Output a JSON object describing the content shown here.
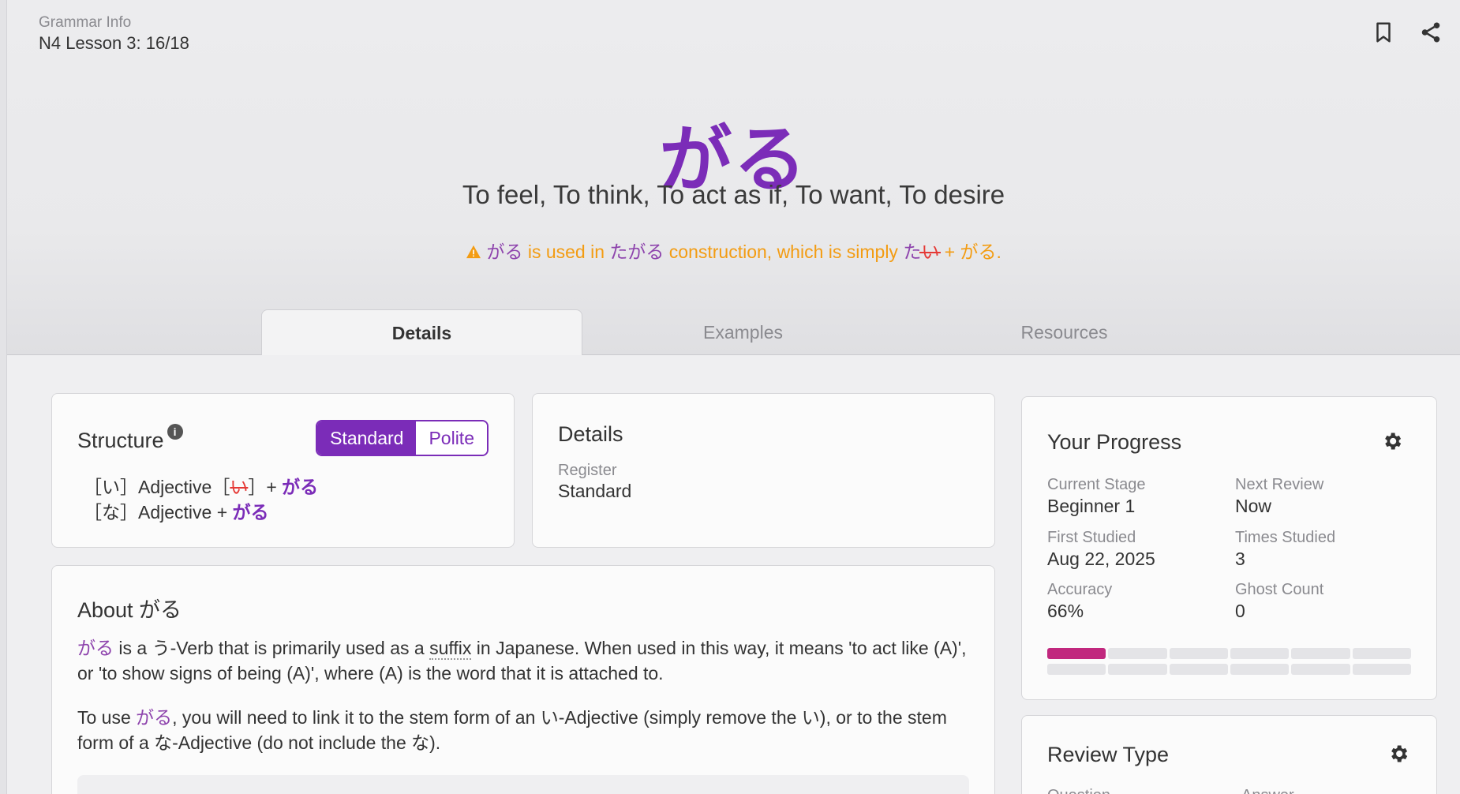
{
  "header": {
    "section_label": "Grammar Info",
    "lesson_label": "N4 Lesson 3: 16/18"
  },
  "icons": {
    "bookmark": "bookmark-icon",
    "share": "share-icon",
    "gear": "gear-icon",
    "warning": "warning-icon",
    "info": "info-icon"
  },
  "grammar": {
    "title": "がる",
    "meaning": "To feel, To think, To act as if, To want, To desire"
  },
  "warning": {
    "part1": "がる",
    "part2": " is used in ",
    "part3": "たがる",
    "part4": " construction, which is simply ",
    "part5a": "た",
    "part5b": "い",
    "part6": " + がる."
  },
  "tabs": [
    "Details",
    "Examples",
    "Resources"
  ],
  "structure": {
    "title": "Structure",
    "toggle_standard": "Standard",
    "toggle_polite": "Polite",
    "line1_pre": "［い］Adjective［",
    "line1_struck": "い",
    "line1_mid": "］+ ",
    "line1_ga": "がる",
    "line2_pre": "［な］Adjective + ",
    "line2_ga": "がる"
  },
  "details": {
    "title": "Details",
    "register_label": "Register",
    "register_value": "Standard"
  },
  "about": {
    "title": "About がる",
    "p1_jp": "がる",
    "p1_a": " is a う-Verb that is primarily used as a ",
    "p1_suffix": "suffix",
    "p1_b": " in Japanese. When used in this way, it means 'to act like (A)', or 'to show signs of being (A)', where (A) is the word that it is attached to.",
    "p2_a": "To use ",
    "p2_jp": "がる",
    "p2_b": ", you will need to link it to the stem form of an い-Adjective (simply remove the い), or to the stem form of a な-Adjective (do not include the な)."
  },
  "progress": {
    "title": "Your Progress",
    "current_stage_label": "Current Stage",
    "current_stage_value": "Beginner 1",
    "next_review_label": "Next Review",
    "next_review_value": "Now",
    "first_studied_label": "First Studied",
    "first_studied_value": "Aug 22, 2025",
    "times_studied_label": "Times Studied",
    "times_studied_value": "3",
    "accuracy_label": "Accuracy",
    "accuracy_value": "66%",
    "ghost_count_label": "Ghost Count",
    "ghost_count_value": "0",
    "segments_filled": 1,
    "segments_total": 6,
    "fill_color": "#c1287e"
  },
  "review": {
    "title": "Review Type",
    "question_label": "Question",
    "answer_label": "Answer"
  },
  "colors": {
    "accent": "#7b2cb8",
    "warning": "#f39c12",
    "strike": "#e53935"
  }
}
